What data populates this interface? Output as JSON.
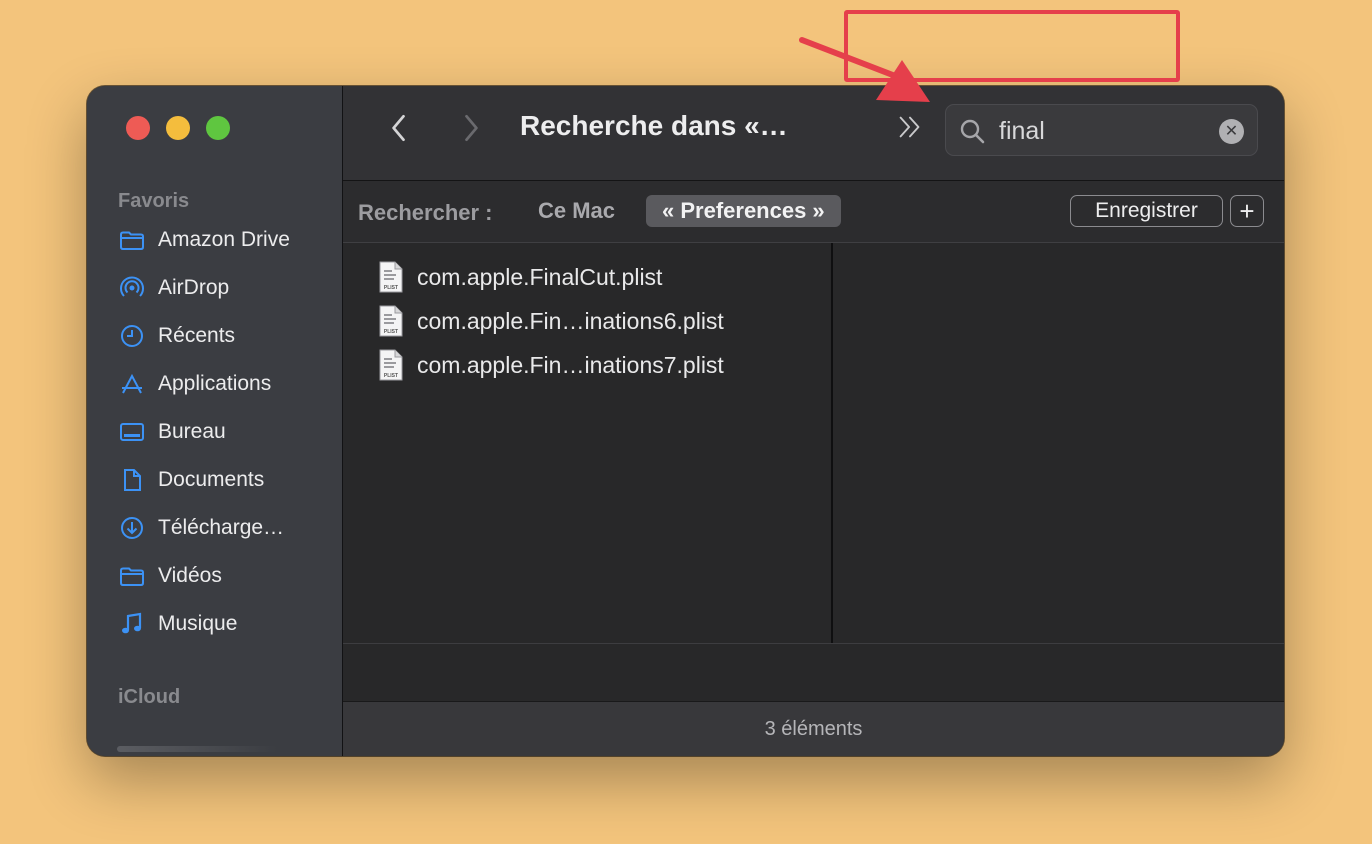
{
  "colors": {
    "background": "#f3c47c",
    "annotation_red": "#e53f4b",
    "folder_blue": "#3c92f5",
    "traffic_close": "#ee5b55",
    "traffic_minimize": "#f4bd3d",
    "traffic_maximize": "#5fc640"
  },
  "sidebar": {
    "favorites_label": "Favoris",
    "items": [
      {
        "label": "Amazon Drive",
        "icon": "folder-icon"
      },
      {
        "label": "AirDrop",
        "icon": "airdrop-icon"
      },
      {
        "label": "Récents",
        "icon": "clock-icon"
      },
      {
        "label": "Applications",
        "icon": "applications-icon"
      },
      {
        "label": "Bureau",
        "icon": "desktop-icon"
      },
      {
        "label": "Documents",
        "icon": "document-icon"
      },
      {
        "label": "Télécharge…",
        "icon": "download-icon"
      },
      {
        "label": "Vidéos",
        "icon": "folder-icon"
      },
      {
        "label": "Musique",
        "icon": "music-note-icon"
      }
    ],
    "icloud_label": "iCloud"
  },
  "toolbar": {
    "title": "Recherche dans «…",
    "search": {
      "value": "final"
    }
  },
  "scopebar": {
    "label": "Rechercher :",
    "scope_mac": "Ce Mac",
    "scope_selected": "« Preferences »",
    "save_label": "Enregistrer",
    "add_label": "+"
  },
  "files": [
    {
      "name": "com.apple.FinalCut.plist",
      "icon_text": "PLIST"
    },
    {
      "name": "com.apple.Fin…inations6.plist",
      "icon_text": "PLIST"
    },
    {
      "name": "com.apple.Fin…inations7.plist",
      "icon_text": "PLIST"
    }
  ],
  "status": {
    "count_text": "3 éléments"
  }
}
